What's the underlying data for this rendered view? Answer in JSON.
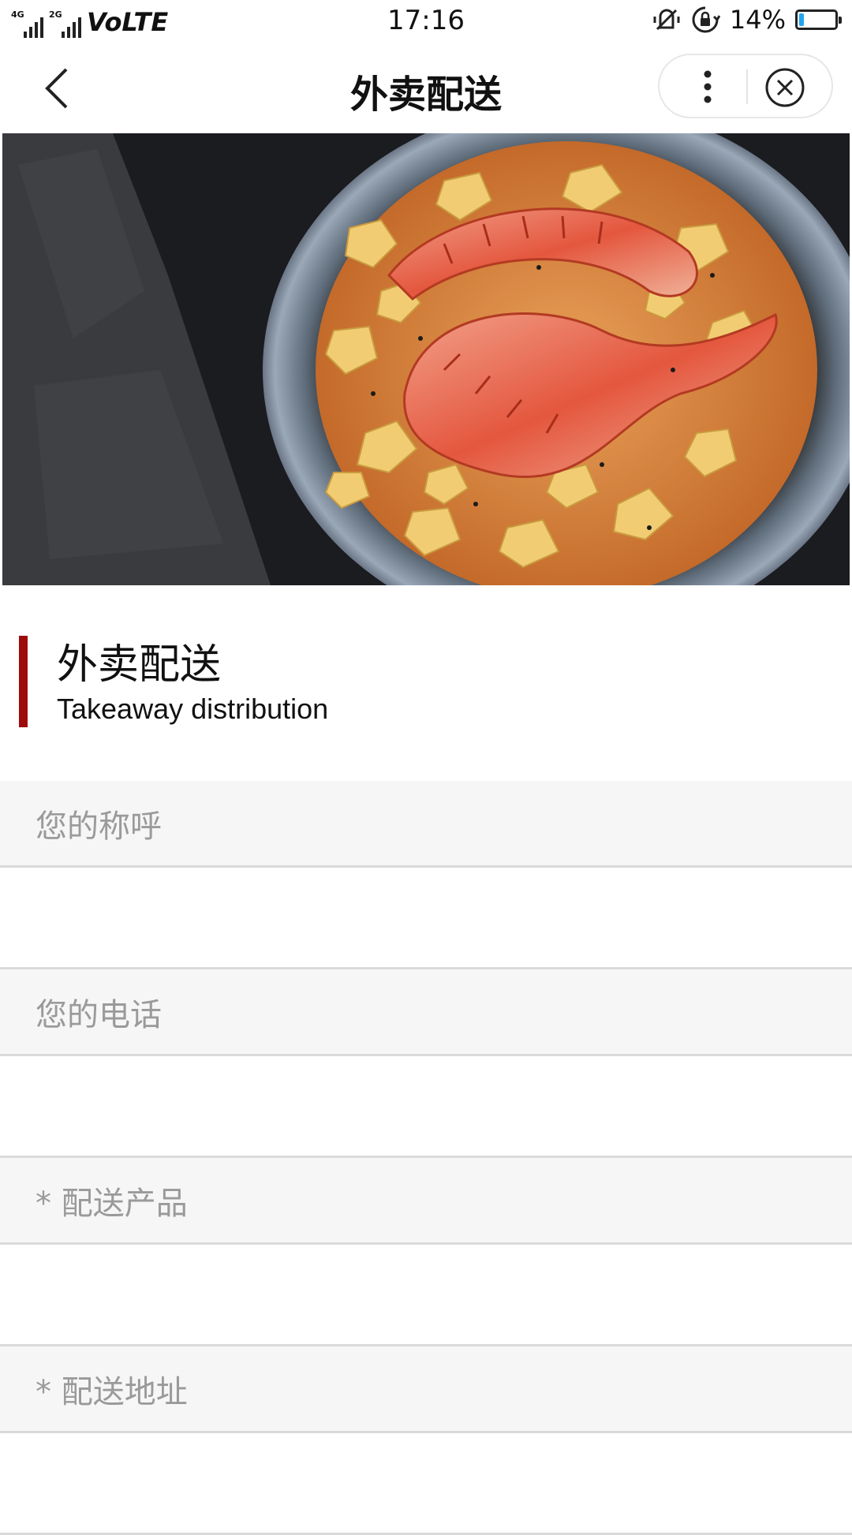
{
  "status_bar": {
    "net_tag_1": "4G",
    "net_tag_2": "2G",
    "volte": "VoLTE",
    "time": "17:16",
    "battery_percent_text": "14%",
    "battery_level": 0.14,
    "icons": [
      "signal-4g-icon",
      "signal-2g-icon",
      "vibrate-mute-icon",
      "rotation-lock-icon",
      "battery-icon"
    ]
  },
  "nav": {
    "title": "外卖配送",
    "icons": [
      "back-arrow-icon",
      "more-dots-icon",
      "close-circle-icon"
    ]
  },
  "hero": {
    "image": "shrimp-pasta-dish"
  },
  "section": {
    "title_cn": "外卖配送",
    "title_en": "Takeaway distribution",
    "accent_color": "#9e0b0b"
  },
  "form": {
    "fields": [
      {
        "label": "您的称呼",
        "value": ""
      },
      {
        "label": "您的电话",
        "value": ""
      },
      {
        "label": "* 配送产品",
        "value": ""
      },
      {
        "label": "* 配送地址",
        "value": ""
      }
    ]
  }
}
